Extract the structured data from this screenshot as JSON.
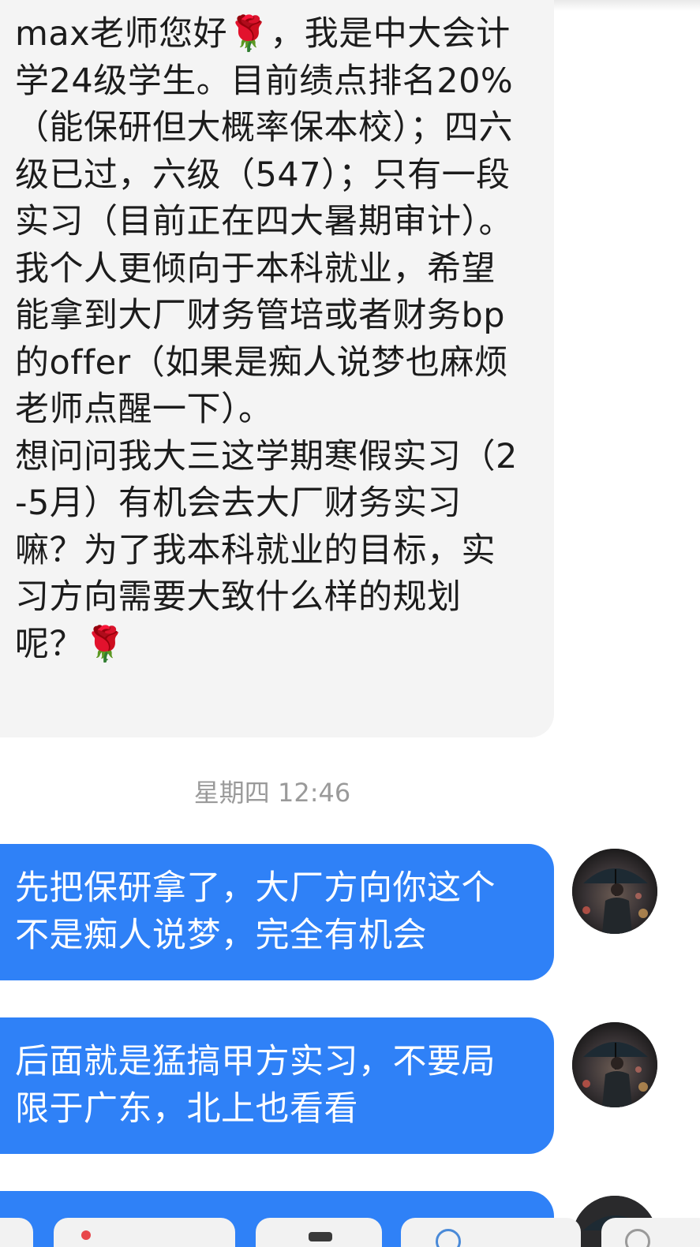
{
  "messages": [
    {
      "side": "incoming",
      "text": "max老师您好🌹，我是中大会计学24级学生。目前绩点排名20%（能保研但大概率保本校）；四六级已过，六级（547）；只有一段实习（目前正在四大暑期审计）。我个人更倾向于本科就业，希望能拿到大厂财务管培或者财务bp的offer（如果是痴人说梦也麻烦老师点醒一下）。\n想问问我大三这学期寒假实习（2-5月）有机会去大厂财务实习嘛？为了我本科就业的目标，实习方向需要大致什么样的规划呢？🌹"
    },
    {
      "side": "outgoing",
      "text": "先把保研拿了，大厂方向你这个不是痴人说梦，完全有机会"
    },
    {
      "side": "outgoing",
      "text": "后面就是猛搞甲方实习，不要局限于广东，北上也看看"
    }
  ],
  "timestamp": "星期四 12:46",
  "avatar": {
    "icon": "umbrella-man-avatar"
  },
  "colors": {
    "incoming_bubble": "#f4f4f4",
    "outgoing_bubble": "#2f81f7",
    "timestamp_text": "#9a9a9a"
  },
  "bottom_bar": {
    "items": [
      {
        "icon": "toolbar-icon"
      },
      {
        "icon": "pin-icon"
      },
      {
        "icon": "cat-icon"
      },
      {
        "icon": "globe-icon"
      },
      {
        "icon": "more-icon"
      }
    ]
  }
}
